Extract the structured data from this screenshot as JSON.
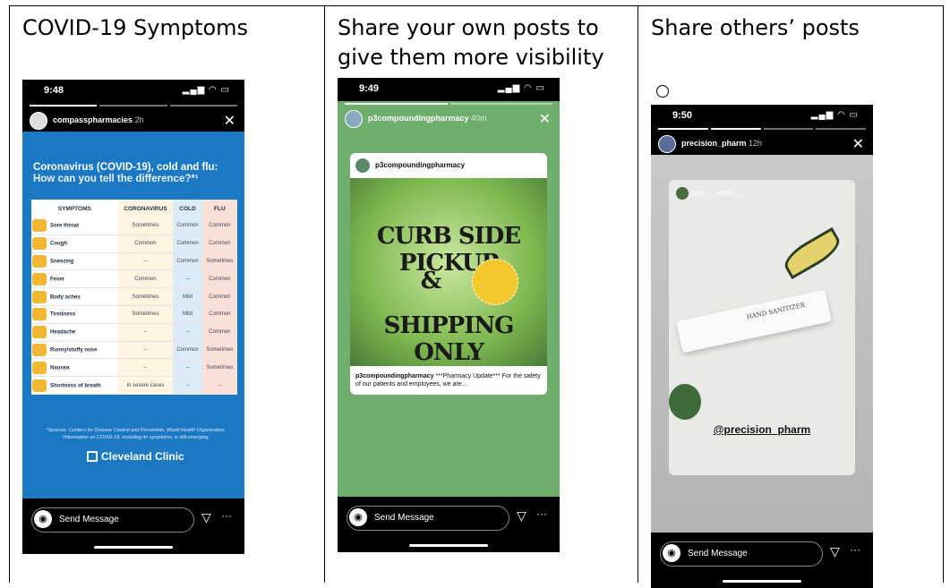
{
  "columns": [
    {
      "heading": "COVID-19 Symptoms"
    },
    {
      "heading": "Share your own posts to give them more visibility"
    },
    {
      "heading": "Share others’ posts"
    }
  ],
  "bullet": "○",
  "covid_phone": {
    "time": "9:48",
    "account": "compasspharmacies",
    "age": "2h",
    "title": "Coronavirus (COVID-19), cold and flu:",
    "subtitle": "How can you tell the difference?*¹",
    "headers": [
      "SYMPTOMS",
      "CORONAVIRUS",
      "COLD",
      "FLU"
    ],
    "rows": [
      [
        "Sore throat",
        "Sometimes",
        "Common",
        "Common"
      ],
      [
        "Cough",
        "Common",
        "Common",
        "Common"
      ],
      [
        "Sneezing",
        "–",
        "Common",
        "Sometimes"
      ],
      [
        "Fever",
        "Common",
        "–",
        "Common"
      ],
      [
        "Body aches",
        "Sometimes",
        "Mild",
        "Common"
      ],
      [
        "Tiredness",
        "Sometimes",
        "Mild",
        "Common"
      ],
      [
        "Headache",
        "–",
        "–",
        "Common"
      ],
      [
        "Runny/stuffy nose",
        "–",
        "Common",
        "Sometimes"
      ],
      [
        "Nausea",
        "–",
        "–",
        "Sometimes"
      ],
      [
        "Shortness of breath",
        "In severe cases",
        "–",
        "–"
      ]
    ],
    "source": "*Sources: Centers for Disease Control and Prevention, World Health Organization ¹Information on COVID-19, including its symptoms, is still emerging",
    "logo": "Cleveland Clinic",
    "send": "Send Message"
  },
  "p3_phone": {
    "time": "9:49",
    "account": "p3compoundingpharmacy",
    "age": "40m",
    "card_account": "p3compoundingpharmacy",
    "line1": "CURB SIDE PICKUP",
    "line2": "&",
    "line3": "SHIPPING ONLY",
    "caption_user": "p3compoundingpharmacy",
    "caption": "***Pharmacy Update*** For the safety of our patients and employees, we are...",
    "send": "Send Message"
  },
  "precision_phone": {
    "time": "9:50",
    "account": "precision_pharm",
    "age": "12h",
    "tagged": "tyler___stella__",
    "product": "HAND SANITIZER",
    "mention": "@precision_pharm",
    "send": "Send Message"
  }
}
